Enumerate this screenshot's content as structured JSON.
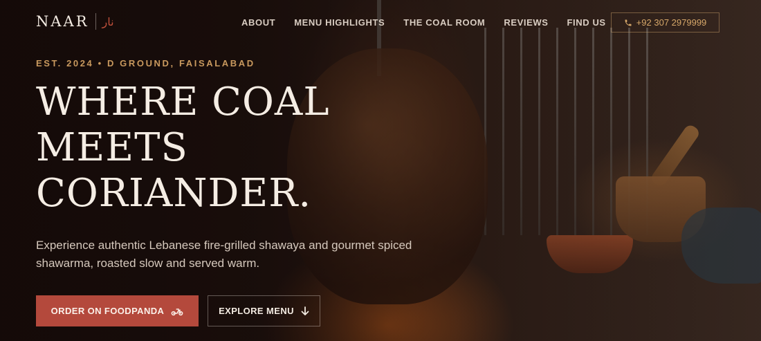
{
  "brand": {
    "name": "NAAR",
    "arabic": "نار"
  },
  "nav": {
    "items": [
      {
        "label": "ABOUT"
      },
      {
        "label": "MENU HIGHLIGHTS"
      },
      {
        "label": "THE COAL ROOM"
      },
      {
        "label": "REVIEWS"
      },
      {
        "label": "FIND US"
      }
    ],
    "phone": "+92 307 2979999"
  },
  "hero": {
    "eyebrow": "EST. 2024 • D GROUND, FAISALABAD",
    "headline_lines": [
      "WHERE COAL",
      "MEETS",
      "CORIANDER."
    ],
    "subtitle": "Experience authentic Lebanese fire-grilled shawaya and gourmet spiced shawarma, roasted slow and served warm.",
    "primary_cta": "ORDER ON FOODPANDA",
    "secondary_cta": "EXPLORE MENU"
  },
  "icons": {
    "phone": "phone-icon",
    "bike": "scooter-icon",
    "arrow": "arrow-down-icon"
  },
  "colors": {
    "accent": "#b4493c",
    "gold": "#c9995e",
    "text": "#f5ede4"
  }
}
